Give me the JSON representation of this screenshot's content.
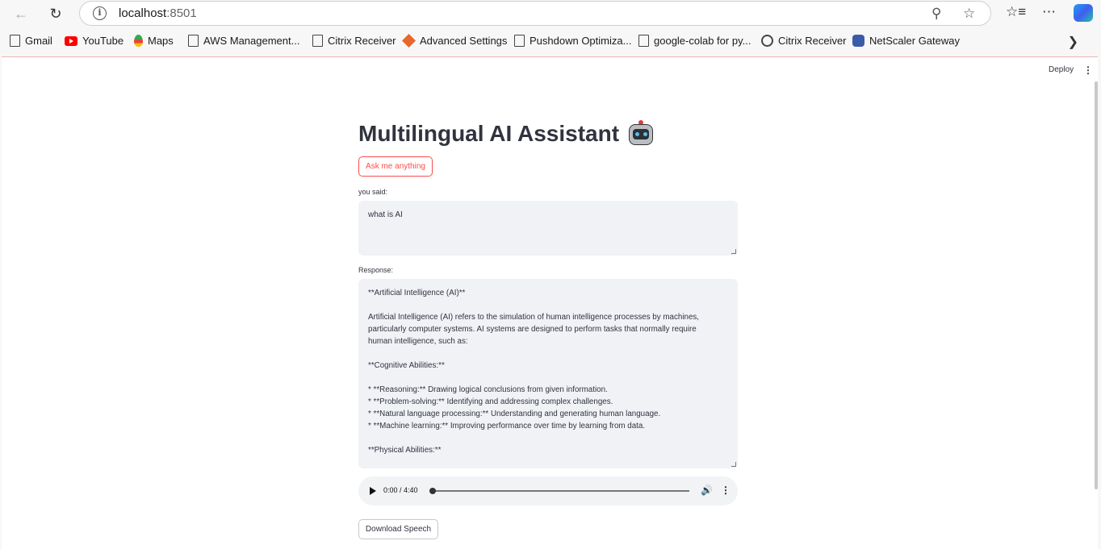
{
  "browser": {
    "url_host": "localhost",
    "url_port": ":8501",
    "bookmarks": [
      {
        "label": "Gmail",
        "icon": "page-icon"
      },
      {
        "label": "YouTube",
        "icon": "youtube-icon"
      },
      {
        "label": "Maps",
        "icon": "maps-icon"
      },
      {
        "label": "AWS Management...",
        "icon": "page-icon"
      },
      {
        "label": "Citrix Receiver",
        "icon": "page-icon"
      },
      {
        "label": "Advanced Settings",
        "icon": "advanced-settings-icon"
      },
      {
        "label": "Pushdown Optimiza...",
        "icon": "page-icon"
      },
      {
        "label": "google-colab for py...",
        "icon": "page-icon"
      },
      {
        "label": "Citrix Receiver",
        "icon": "citrix-icon"
      },
      {
        "label": "NetScaler Gateway",
        "icon": "netscaler-icon"
      }
    ]
  },
  "app": {
    "deploy_label": "Deploy",
    "title": "Multilingual AI Assistant",
    "title_icon": "robot-icon",
    "ask_button": "Ask me anything",
    "you_said_label": "you said:",
    "you_said_value": "what is AI",
    "response_label": "Response:",
    "response_lines": [
      "**Artificial Intelligence (AI)**",
      "",
      "Artificial Intelligence (AI) refers to the simulation of human intelligence processes by machines,",
      "particularly computer systems. AI systems are designed to perform tasks that normally require",
      "human intelligence, such as:",
      "",
      "**Cognitive Abilities:**",
      "",
      "* **Reasoning:** Drawing logical conclusions from given information.",
      "* **Problem-solving:** Identifying and addressing complex challenges.",
      "* **Natural language processing:** Understanding and generating human language.",
      "* **Machine learning:** Improving performance over time by learning from data.",
      "",
      "**Physical Abilities:**"
    ],
    "audio_time": "0:00 / 4:40",
    "download_button": "Download Speech"
  }
}
